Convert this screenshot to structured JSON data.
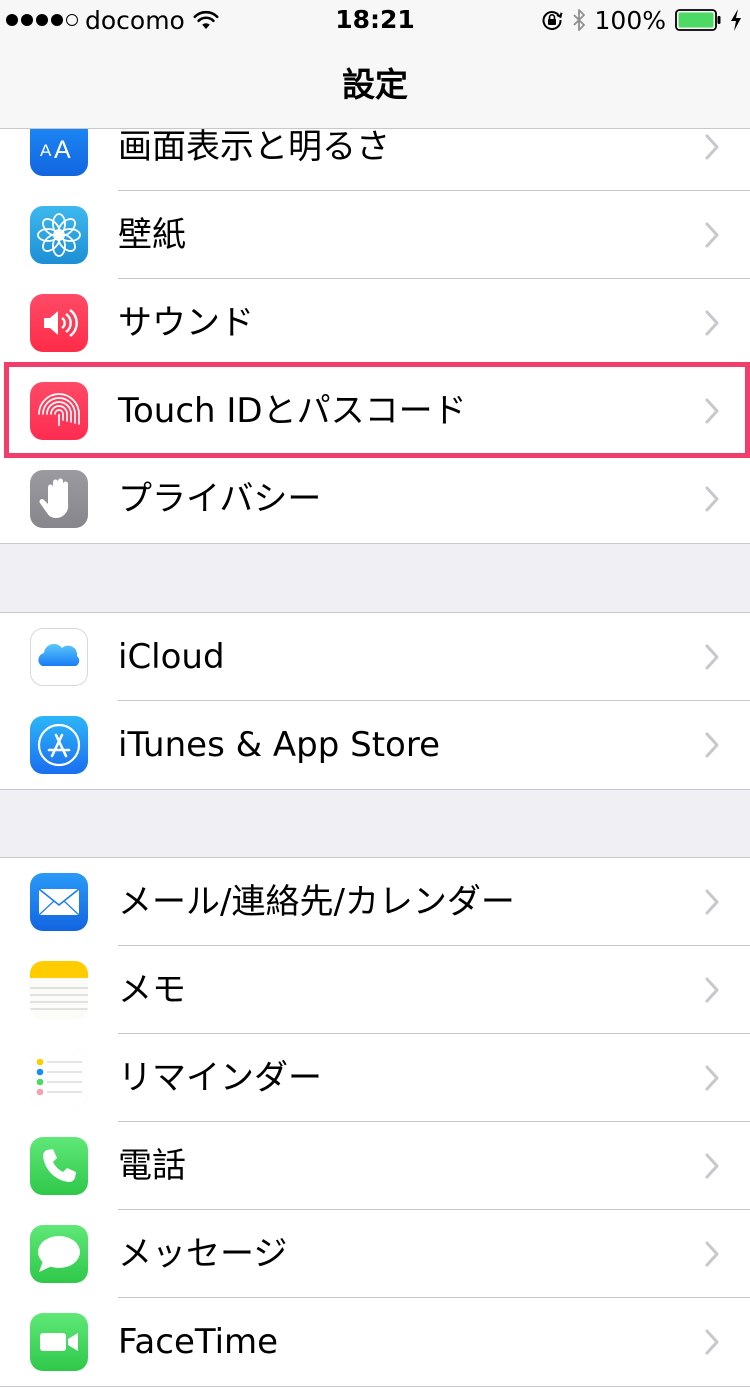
{
  "status_bar": {
    "carrier": "docomo",
    "signal_bars_filled": 4,
    "signal_bars_total": 5,
    "time": "18:21",
    "battery_percent": "100%",
    "battery_fill": 1.0,
    "icons": [
      "wifi-icon",
      "rotation-lock-icon",
      "bluetooth-icon",
      "charging-bolt-icon"
    ]
  },
  "nav": {
    "title": "設定"
  },
  "colors": {
    "accent_highlight": "#f23d6a",
    "battery_green": "#4cd964",
    "separator": "#c8c7cc",
    "background": "#efeff4"
  },
  "groups": [
    {
      "name": "display-group",
      "items": [
        {
          "id": "display",
          "label": "画面表示と明るさ",
          "icon": "display-brightness-icon",
          "icon_text": "AA",
          "icon_color": "#1a7cf5"
        },
        {
          "id": "wallpaper",
          "label": "壁紙",
          "icon": "wallpaper-flower-icon",
          "icon_color": "#2fa8e0"
        },
        {
          "id": "sound",
          "label": "サウンド",
          "icon": "speaker-icon",
          "icon_color": "#fe3855"
        },
        {
          "id": "touch-id",
          "label": "Touch IDとパスコード",
          "icon": "fingerprint-icon",
          "icon_color": "#fe3859",
          "highlighted": true
        },
        {
          "id": "privacy",
          "label": "プライバシー",
          "icon": "hand-icon",
          "icon_color": "#8e8e93"
        }
      ]
    },
    {
      "name": "cloud-group",
      "items": [
        {
          "id": "icloud",
          "label": "iCloud",
          "icon": "cloud-icon",
          "icon_color": "#ffffff"
        },
        {
          "id": "itunes",
          "label": "iTunes & App Store",
          "icon": "app-store-icon",
          "icon_color": "#1a8cf5"
        }
      ]
    },
    {
      "name": "apps-group",
      "items": [
        {
          "id": "mail",
          "label": "メール/連絡先/カレンダー",
          "icon": "mail-envelope-icon",
          "icon_color": "#1a7cf5"
        },
        {
          "id": "notes",
          "label": "メモ",
          "icon": "notes-icon",
          "icon_color": "#ffcc00"
        },
        {
          "id": "reminders",
          "label": "リマインダー",
          "icon": "reminders-list-icon",
          "icon_color": "#ffffff"
        },
        {
          "id": "phone",
          "label": "電話",
          "icon": "phone-handset-icon",
          "icon_color": "#4cd964"
        },
        {
          "id": "messages",
          "label": "メッセージ",
          "icon": "speech-bubble-icon",
          "icon_color": "#4cd964"
        },
        {
          "id": "facetime",
          "label": "FaceTime",
          "icon": "video-camera-icon",
          "icon_color": "#4cd964"
        }
      ]
    }
  ]
}
